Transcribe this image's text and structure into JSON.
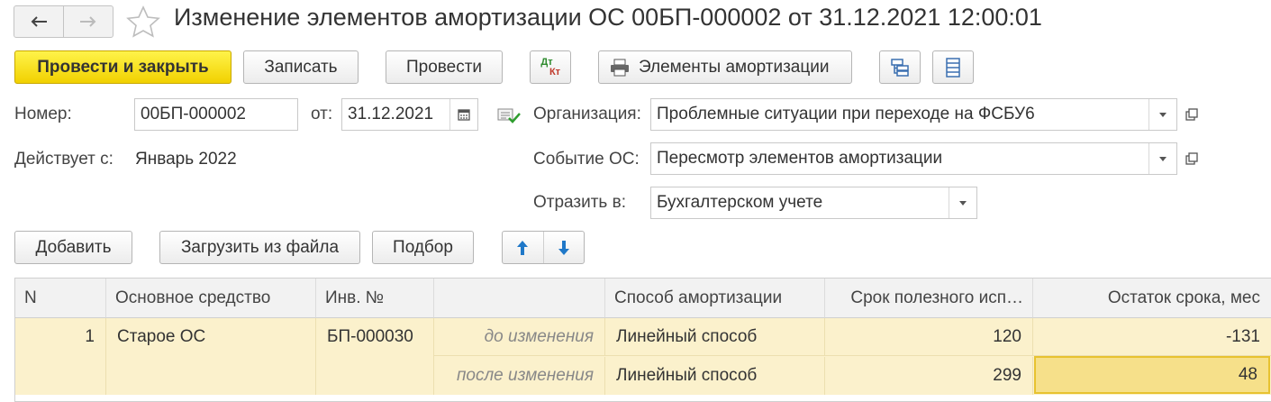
{
  "header": {
    "title": "Изменение элементов амортизации ОС 00БП-000002 от 31.12.2021 12:00:01"
  },
  "toolbar": {
    "post_close": "Провести и закрыть",
    "save": "Записать",
    "post": "Провести",
    "dtkt_top": "Дт",
    "dtkt_bottom": "Кт",
    "depreciation_elements": "Элементы амортизации"
  },
  "form": {
    "number_label": "Номер:",
    "number_value": "00БП-000002",
    "from_label": "от:",
    "date_value": "31.12.2021",
    "valid_from_label": "Действует с:",
    "valid_from_value": "Январь 2022",
    "organization_label": "Организация:",
    "organization_value": "Проблемные ситуации при переходе на ФСБУ6",
    "event_label": "Событие ОС:",
    "event_value": "Пересмотр элементов амортизации",
    "reflect_label": "Отразить в:",
    "reflect_value": "Бухгалтерском учете"
  },
  "table_toolbar": {
    "add": "Добавить",
    "load_file": "Загрузить из файла",
    "pick": "Подбор"
  },
  "table": {
    "columns": [
      "N",
      "Основное средство",
      "Инв. №",
      "",
      "Способ амортизации",
      "Срок полезного исп…",
      "Остаток срока, мес"
    ],
    "rows": [
      {
        "n": "1",
        "asset": "Старое ОС",
        "inv": "БП-000030",
        "before_label": "до изменения",
        "before_method": "Линейный способ",
        "before_term": "120",
        "before_remaining": "-131",
        "after_label": "после изменения",
        "after_method": "Линейный способ",
        "after_term": "299",
        "after_remaining": "48"
      }
    ]
  },
  "colors": {
    "accent_yellow": "#f1d100",
    "row_highlight": "#fbf1cc",
    "selected_cell": "#f6e08a",
    "arrow_blue": "#1f78c8"
  }
}
